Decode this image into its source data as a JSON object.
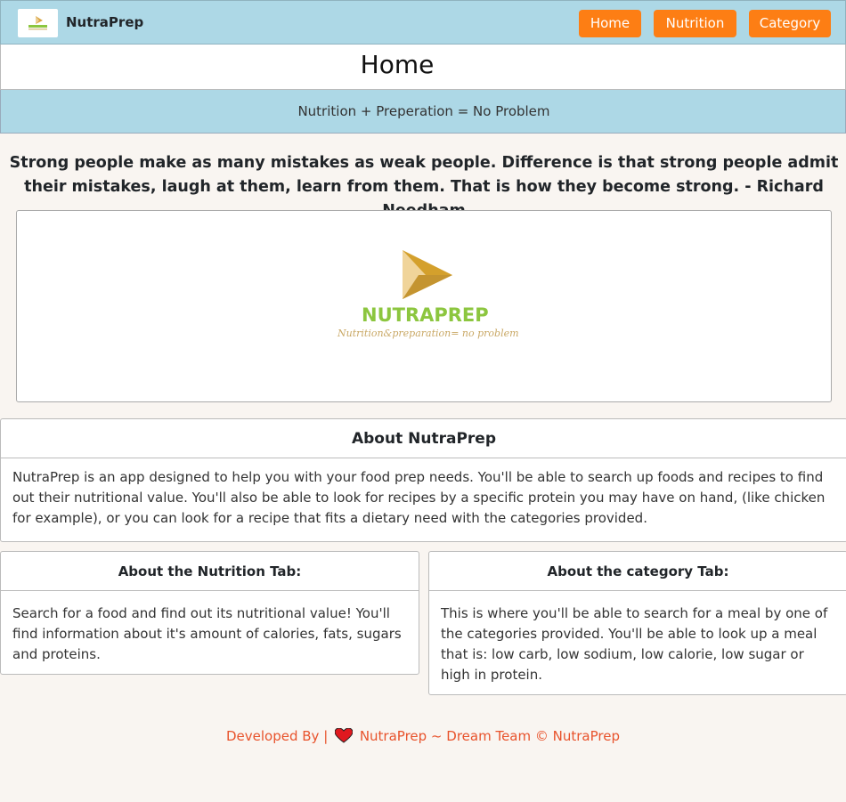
{
  "navbar": {
    "brand": "NutraPrep",
    "links": [
      "Home",
      "Nutrition",
      "Category"
    ]
  },
  "page": {
    "title": "Home",
    "tagline": "Nutrition + Preperation = No Problem",
    "quote": "Strong people make as many mistakes as weak people. Difference is that strong people admit their mistakes, laugh at them, learn from them. That is how they become strong. - Richard Needham"
  },
  "hero": {
    "logo_word": "NUTRAPREP",
    "logo_slogan": "Nutrition&preparation= no problem"
  },
  "about": {
    "title": "About NutraPrep",
    "body": "NutraPrep is an app designed to help you with your food prep needs. You'll be able to search up foods and recipes to find out their nutritional value. You'll also be able to look for recipes by a specific protein you may have on hand, (like chicken for example), or you can look for a recipe that fits a dietary need with the categories provided."
  },
  "nutrition_tab": {
    "title": "About the Nutrition Tab:",
    "body": "Search for a food and find out its nutritional value! You'll find information about it's amount of calories, fats, sugars and proteins."
  },
  "category_tab": {
    "title": "About the category Tab:",
    "body": "This is where you'll be able to search for a meal by one of the categories provided. You'll be able to look up a meal that is: low carb, low sodium, low calorie, low sugar or high in protein."
  },
  "footer": {
    "developed_by": "Developed By |",
    "credit": "NutraPrep ~ Dream Team © NutraPrep"
  },
  "colors": {
    "navbar_bg": "#add8e6",
    "button_bg": "#fd7e14",
    "footer_text": "#e8532c",
    "logo_green": "#8cc63f",
    "logo_gold": "#d9a441"
  },
  "icons": [
    "logo-icon",
    "heart-icon"
  ]
}
